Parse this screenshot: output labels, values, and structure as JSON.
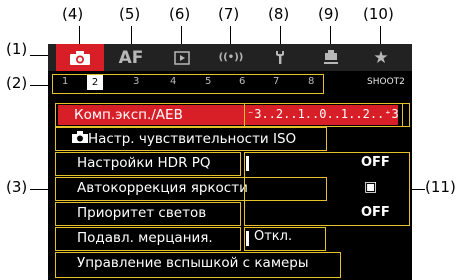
{
  "callouts": {
    "top": [
      "(4)",
      "(5)",
      "(6)",
      "(7)",
      "(8)",
      "(9)",
      "(10)"
    ],
    "left": [
      "(1)",
      "(2)",
      "(3)"
    ],
    "right": "(11)"
  },
  "tabs": [
    {
      "label": "",
      "icon": "camera-icon",
      "active": true
    },
    {
      "label": "AF",
      "icon": "",
      "active": false
    },
    {
      "label": "▶",
      "icon": "playback-icon",
      "active": false
    },
    {
      "label": "((•))",
      "icon": "wireless-icon",
      "active": false
    },
    {
      "label": "🔧",
      "icon": "wrench-icon",
      "active": false
    },
    {
      "label": "",
      "icon": "custom-functions-icon",
      "active": false
    },
    {
      "label": "★",
      "icon": "star-icon",
      "active": false
    }
  ],
  "pages": [
    "1",
    "2",
    "3",
    "4",
    "5",
    "6",
    "7",
    "8"
  ],
  "active_page": "2",
  "page_label": "SHOOT2",
  "menu": [
    {
      "label": "Комп.эксп./AEB",
      "value": "⁻3..2..1..0..1..2..⁺3",
      "selected": true
    },
    {
      "label": "Настр. чувствительности ISO",
      "value": "",
      "selected": false,
      "icon": "camera-small-icon"
    },
    {
      "label": "Настройки HDR PQ",
      "value": "OFF",
      "selected": false
    },
    {
      "label": "Автокоррекция яркости",
      "value": "▣",
      "selected": false
    },
    {
      "label": "Приоритет светов",
      "value": "OFF",
      "selected": false
    },
    {
      "label": "Подавл. мерцания.",
      "value": "Откл.",
      "selected": false
    },
    {
      "label": "Управление вспышкой с камеры",
      "value": "",
      "selected": false
    }
  ],
  "colors": {
    "accent": "#d81f27",
    "highlight": "#e4c12a"
  }
}
